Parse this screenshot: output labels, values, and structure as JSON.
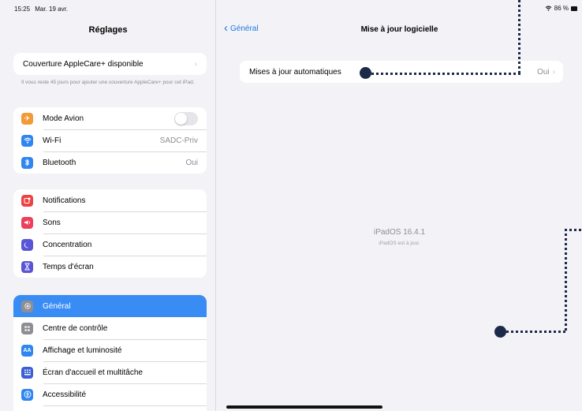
{
  "status_bar": {
    "time": "15:25",
    "date": "Mar. 19 avr.",
    "battery": "86 %"
  },
  "sidebar": {
    "title": "Réglages",
    "applecare": {
      "label": "Couverture AppleCare+ disponible",
      "footnote": "Il vous reste 45 jours pour ajouter une couverture AppleCare+ pour cet iPad."
    },
    "connectivity": [
      {
        "label": "Mode Avion",
        "icon": "airplane-icon",
        "color": "#f29a37"
      },
      {
        "label": "Wi-Fi",
        "value": "SADC-Priv",
        "icon": "wifi-icon",
        "color": "#2f86f0"
      },
      {
        "label": "Bluetooth",
        "value": "Oui",
        "icon": "bluetooth-icon",
        "color": "#2f86f0"
      }
    ],
    "notifications": [
      {
        "label": "Notifications",
        "icon": "notifications-icon",
        "color": "#ec4444"
      },
      {
        "label": "Sons",
        "icon": "sound-icon",
        "color": "#ec3f5c"
      },
      {
        "label": "Concentration",
        "icon": "moon-icon",
        "color": "#5a55d6"
      },
      {
        "label": "Temps d'écran",
        "icon": "hourglass-icon",
        "color": "#5a55d6"
      }
    ],
    "general": [
      {
        "label": "Général",
        "icon": "gear-icon",
        "color": "#8e8e93",
        "selected": true
      },
      {
        "label": "Centre de contrôle",
        "icon": "control-center-icon",
        "color": "#8e8e93"
      },
      {
        "label": "Affichage et luminosité",
        "icon": "display-icon",
        "color": "#2f86f0"
      },
      {
        "label": "Écran d'accueil et multitâche",
        "icon": "home-screen-icon",
        "color": "#3b5fd4"
      },
      {
        "label": "Accessibilité",
        "icon": "accessibility-icon",
        "color": "#2f86f0"
      }
    ]
  },
  "detail": {
    "back_label": "Général",
    "title": "Mise à jour logicielle",
    "auto_updates": {
      "label": "Mises à jour automatiques",
      "value": "Oui"
    },
    "os_version": "iPadOS 16.4.1",
    "os_status": "iPadOS est à jour."
  }
}
